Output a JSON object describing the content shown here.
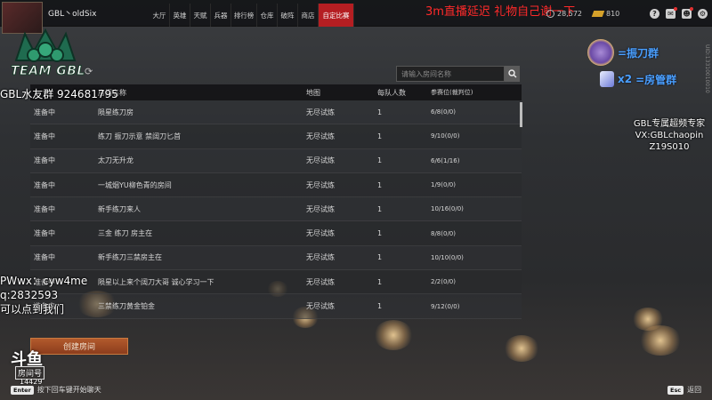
{
  "player": {
    "name": "GBL丶oldSix"
  },
  "nav": {
    "items": [
      {
        "label": "大厅"
      },
      {
        "label": "英雄"
      },
      {
        "label": "天赋"
      },
      {
        "label": "兵器"
      },
      {
        "label": "排行榜"
      },
      {
        "label": "仓库"
      },
      {
        "label": "破阵"
      },
      {
        "label": "商店"
      },
      {
        "label": "自定比赛"
      }
    ],
    "active": "自定比赛"
  },
  "stream_note": "3m直播延迟 礼物自己谢一下",
  "currency": {
    "coins": "28,572",
    "gold": "810"
  },
  "colors": {
    "accent": "#b51e22",
    "overlay_red": "#ff2a2a",
    "group_blue": "#4aa0ff",
    "create_button": "#a04a24"
  },
  "side_id": "UID:13310010010",
  "team_logo": {
    "text": "TEAM GBL"
  },
  "search": {
    "placeholder": "请输入房间名称"
  },
  "table": {
    "headers": [
      "",
      "房间名称",
      "地图",
      "每队人数",
      "参赛位(裁判位)"
    ],
    "rows": [
      {
        "status": "准备中",
        "name": "陨星练刀房",
        "map": "无尽试炼",
        "count": "1",
        "seats": "6/8(0/0)"
      },
      {
        "status": "准备中",
        "name": "练刀 振刀示意 禁阔刀匕首",
        "map": "无尽试炼",
        "count": "1",
        "seats": "9/10(0/0)"
      },
      {
        "status": "准备中",
        "name": "太刀无升龙",
        "map": "无尽试炼",
        "count": "1",
        "seats": "6/6(1/16)"
      },
      {
        "status": "准备中",
        "name": "一城烟YU柳色青的房间",
        "map": "无尽试炼",
        "count": "1",
        "seats": "1/9(0/0)"
      },
      {
        "status": "准备中",
        "name": "新手练刀来人",
        "map": "无尽试炼",
        "count": "1",
        "seats": "10/16(0/0)"
      },
      {
        "status": "准备中",
        "name": "三金 练刀 房主在",
        "map": "无尽试炼",
        "count": "1",
        "seats": "8/8(0/0)"
      },
      {
        "status": "准备中",
        "name": "新手练刀三禁房主在",
        "map": "无尽试炼",
        "count": "1",
        "seats": "10/10(0/0)"
      },
      {
        "status": "准备中",
        "name": "陨星以上来个阔刀大哥 诚心学习一下",
        "map": "无尽试炼",
        "count": "1",
        "seats": "2/2(0/0)"
      },
      {
        "status": "准备中",
        "name": "三禁练刀黄金铂金",
        "map": "无尽试炼",
        "count": "1",
        "seats": "9/12(0/0)"
      }
    ]
  },
  "overlay": {
    "fan_group": "GBL水友群 924681795",
    "contact_lines": [
      "PWwx：cyw4me",
      "q:2832593",
      "可以点到我们"
    ],
    "right_lines": [
      "GBL专属超频专家",
      "VX:GBLchaopin",
      "Z19S010"
    ],
    "group_zhendao": "=振刀群",
    "group_x2": "x2",
    "group_fangguan": "=房管群"
  },
  "create_button": "创建房间",
  "douyu": {
    "brand": "斗鱼",
    "room_label": "房间号",
    "room_number": "14429"
  },
  "hints": {
    "enter_key": "Enter",
    "enter_text": "按下回车键开始聊天",
    "esc_key": "Esc",
    "esc_text": "返回"
  }
}
